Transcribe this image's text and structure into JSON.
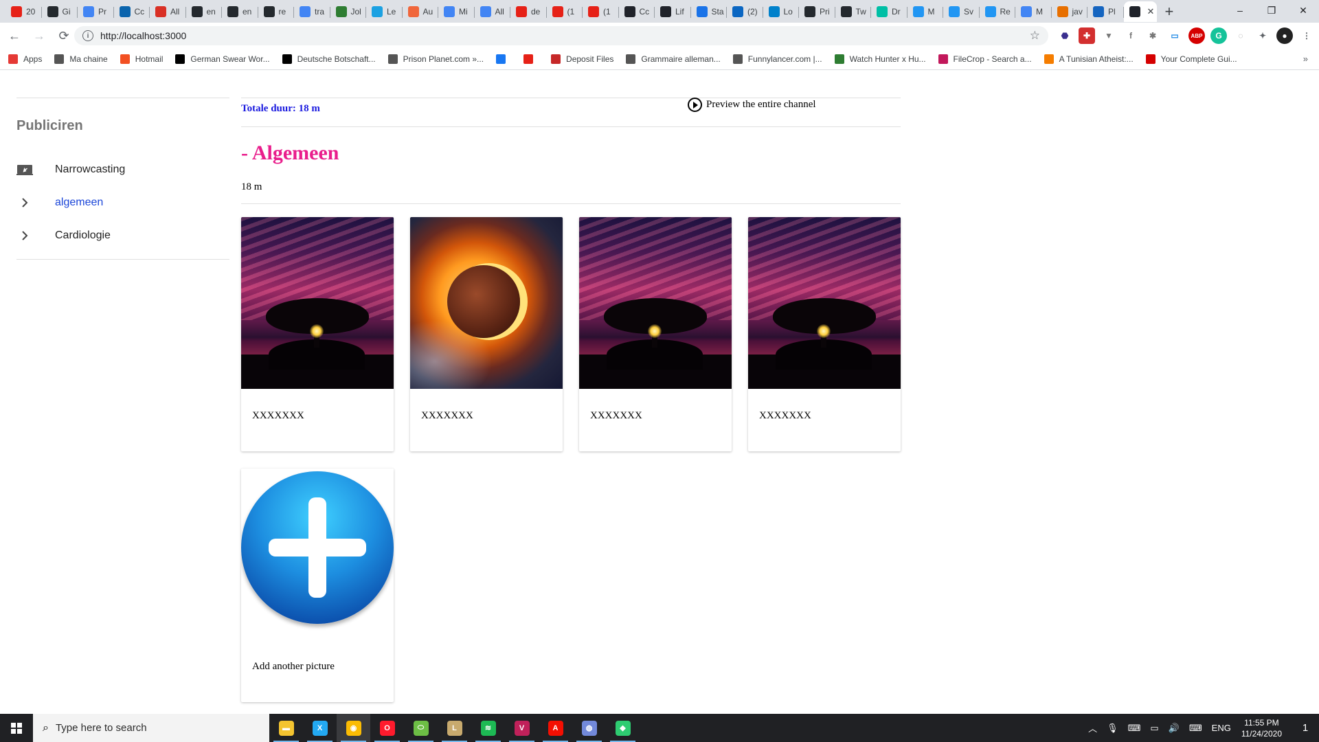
{
  "browser": {
    "tabs": [
      {
        "label": "20",
        "icon": "youtube-icon",
        "color": "#e62117"
      },
      {
        "label": "Gi",
        "icon": "github-icon",
        "color": "#24292e"
      },
      {
        "label": "Pr",
        "icon": "google-icon",
        "color": "#4285f4"
      },
      {
        "label": "Cc",
        "icon": "outlook-icon",
        "color": "#0a64ad"
      },
      {
        "label": "All",
        "icon": "gmail-icon",
        "color": "#d93025"
      },
      {
        "label": "en",
        "icon": "github-icon",
        "color": "#24292e"
      },
      {
        "label": "en",
        "icon": "github-icon",
        "color": "#24292e"
      },
      {
        "label": "re",
        "icon": "github-icon",
        "color": "#24292e"
      },
      {
        "label": "tra",
        "icon": "google-icon",
        "color": "#4285f4"
      },
      {
        "label": "Jol",
        "icon": "jobs-icon",
        "color": "#2e7d32"
      },
      {
        "label": "Le",
        "icon": "sl-icon",
        "color": "#1ba1e2"
      },
      {
        "label": "Au",
        "icon": "au-icon",
        "color": "#f0663b"
      },
      {
        "label": "Mi",
        "icon": "google-icon",
        "color": "#4285f4"
      },
      {
        "label": "All",
        "icon": "google-icon",
        "color": "#4285f4"
      },
      {
        "label": "de",
        "icon": "youtube-icon",
        "color": "#e62117"
      },
      {
        "label": "(1",
        "icon": "youtube-icon",
        "color": "#e62117"
      },
      {
        "label": "(1",
        "icon": "youtube-icon",
        "color": "#e62117"
      },
      {
        "label": "Cc",
        "icon": "react-icon",
        "color": "#20232a"
      },
      {
        "label": "Lif",
        "icon": "react-icon",
        "color": "#20232a"
      },
      {
        "label": "Sta",
        "icon": "chart-icon",
        "color": "#1a73e8"
      },
      {
        "label": "(2)",
        "icon": "linkedin-icon",
        "color": "#0a66c2"
      },
      {
        "label": "Lo",
        "icon": "mui-icon",
        "color": "#0081cb"
      },
      {
        "label": "Pri",
        "icon": "github-icon",
        "color": "#24292e"
      },
      {
        "label": "Tw",
        "icon": "github-icon",
        "color": "#24292e"
      },
      {
        "label": "Dr",
        "icon": "dr-icon",
        "color": "#00bfa5"
      },
      {
        "label": "M",
        "icon": "m-icon",
        "color": "#2196f3"
      },
      {
        "label": "Sv",
        "icon": "sv-icon",
        "color": "#2196f3"
      },
      {
        "label": "Re",
        "icon": "re-icon",
        "color": "#2196f3"
      },
      {
        "label": "M",
        "icon": "google-icon",
        "color": "#4285f4"
      },
      {
        "label": "jav",
        "icon": "java-icon",
        "color": "#e76f00"
      },
      {
        "label": "Pl",
        "icon": "flag-icon",
        "color": "#1565c0"
      },
      {
        "label": "",
        "icon": "react-icon",
        "color": "#20232a",
        "active": true
      }
    ],
    "new_tab": "+",
    "window_controls": {
      "minimize": "–",
      "maximize": "❐",
      "close": "✕"
    },
    "url": "http://localhost:3000",
    "bookmarks": [
      {
        "label": "Apps",
        "icon": "apps-grid-icon",
        "color": "#e53935"
      },
      {
        "label": "Ma chaine",
        "icon": "globe-icon",
        "color": "#555555"
      },
      {
        "label": "Hotmail",
        "icon": "microsoft-icon",
        "color": "#f25022"
      },
      {
        "label": "German Swear Wor...",
        "icon": "exclamation-icon",
        "color": "#000000"
      },
      {
        "label": "Deutsche Botschaft...",
        "icon": "flag-icon",
        "color": "#000000"
      },
      {
        "label": "Prison Planet.com »...",
        "icon": "globe-icon",
        "color": "#555555"
      },
      {
        "label": "",
        "icon": "facebook-icon",
        "color": "#1877f2"
      },
      {
        "label": "",
        "icon": "youtube-icon",
        "color": "#e62117"
      },
      {
        "label": "Deposit Files",
        "icon": "deposit-icon",
        "color": "#c62828"
      },
      {
        "label": "Grammaire alleman...",
        "icon": "globe-icon",
        "color": "#555555"
      },
      {
        "label": "Funnylancer.com |...",
        "icon": "globe-icon",
        "color": "#555555"
      },
      {
        "label": "Watch Hunter x Hu...",
        "icon": "hunter-icon",
        "color": "#2e7d32"
      },
      {
        "label": "FileCrop - Search a...",
        "icon": "filecrop-icon",
        "color": "#c2185b"
      },
      {
        "label": "A Tunisian Atheist:...",
        "icon": "blogger-icon",
        "color": "#f57d00"
      },
      {
        "label": "Your Complete Gui...",
        "icon": "rh-icon",
        "color": "#d50000"
      }
    ]
  },
  "sidebar": {
    "title": "Publiciren",
    "items": [
      {
        "label": "Narrowcasting",
        "icon": "screen-share-icon",
        "active": false
      },
      {
        "label": "algemeen",
        "icon": "chevron-right-icon",
        "active": true
      },
      {
        "label": "Cardiologie",
        "icon": "chevron-right-icon",
        "active": false
      }
    ]
  },
  "main": {
    "total_duration": "Totale duur: 18 m",
    "preview_label": "Preview the entire channel",
    "section_title": "- Algemeen",
    "section_duration": "18 m",
    "cards": [
      {
        "caption": "XXXXXXX",
        "image": "tree-sunset"
      },
      {
        "caption": "XXXXXXX",
        "image": "solar-eclipse"
      },
      {
        "caption": "XXXXXXX",
        "image": "tree-sunset"
      },
      {
        "caption": "XXXXXXX",
        "image": "tree-sunset"
      }
    ],
    "add_card_caption": "Add another picture"
  },
  "taskbar": {
    "search_placeholder": "Type here to search",
    "apps": [
      {
        "icon": "file-explorer-icon",
        "color": "#f4c430",
        "glyph": "▬"
      },
      {
        "icon": "vscode-icon",
        "color": "#23a9f2",
        "glyph": "X"
      },
      {
        "icon": "chrome-icon",
        "color": "#fbbc04",
        "glyph": "◉",
        "selected": true
      },
      {
        "icon": "opera-icon",
        "color": "#ff1b2d",
        "glyph": "O"
      },
      {
        "icon": "app-green-icon",
        "color": "#6dbe45",
        "glyph": "⬭"
      },
      {
        "icon": "app-lol-icon",
        "color": "#c8aa6e",
        "glyph": "L"
      },
      {
        "icon": "spotify-icon",
        "color": "#1db954",
        "glyph": "≋"
      },
      {
        "icon": "vivaldi-icon",
        "color": "#c0215a",
        "glyph": "V"
      },
      {
        "icon": "acrobat-icon",
        "color": "#f40f02",
        "glyph": "A"
      },
      {
        "icon": "discord-icon",
        "color": "#7289da",
        "glyph": "◍"
      },
      {
        "icon": "git-icon",
        "color": "#2ecc71",
        "glyph": "◆"
      }
    ],
    "tray_language": "ENG",
    "time": "11:55 PM",
    "date": "11/24/2020",
    "notifications": "1"
  }
}
